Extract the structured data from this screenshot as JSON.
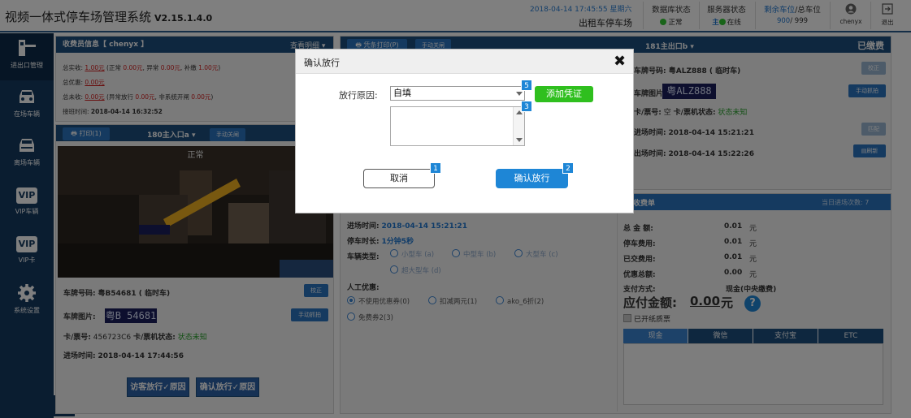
{
  "header": {
    "title": "视频一体式停车场管理系统",
    "version": "V2.15.1.4.0",
    "datetime": "2018-04-14 17:45:55 星期六",
    "lot_name": "出租车停车场",
    "db_status_label": "数据库状态",
    "db_status_value": "正常",
    "server_status_label": "服务器状态",
    "server_main": "主",
    "server_status_value": "在线",
    "spaces_label_remaining": "剩余车位",
    "spaces_label_total": "/总车位",
    "spaces_remaining": "900",
    "spaces_total": "/ 999",
    "user": "chenyx",
    "logout_label": "退出"
  },
  "sidebar": {
    "items": [
      {
        "label": "进出口管理",
        "icon": "gate-icon"
      },
      {
        "label": "在场车辆",
        "icon": "car-icon"
      },
      {
        "label": "离场车辆",
        "icon": "car-exit-icon"
      },
      {
        "label": "VIP车辆",
        "icon": "vip-icon"
      },
      {
        "label": "VIP卡",
        "icon": "vip-card-icon"
      },
      {
        "label": "系统设置",
        "icon": "gear-icon"
      }
    ],
    "vip_text": "VIP"
  },
  "cashier": {
    "title": "收费员信息【 chenyx 】",
    "detail_link": "查看明细",
    "total_label": "总实收:",
    "total_value": "1.00元",
    "total_detail_a": "(正常",
    "total_normal": "0.00元",
    "total_detail_b": ", 异常",
    "total_abnormal": "0.00元",
    "total_detail_c": ", 补缴",
    "total_supplement": "1.00元",
    "total_detail_d": ")",
    "discount_label": "总优惠:",
    "discount_value": "0.00元",
    "uncollected_label": "总未收:",
    "uncollected_value": "0.00元",
    "uncollected_detail_a": "(异常放行",
    "uncollected_release": "0.00元",
    "uncollected_detail_b": ", 非系统开闸",
    "uncollected_manual": "0.00元",
    "uncollected_detail_c": ")",
    "shift_label": "接班时间:",
    "shift_value": "2018-04-14 16:32:52"
  },
  "entrance": {
    "print_label": "打印(1)",
    "camera_name": "180主入口a",
    "manual_close": "手动关闸",
    "status": "正常",
    "plate_label": "车牌号码:",
    "plate_value": "粤B54681 ( 临时车)",
    "correct_btn": "校正",
    "plate_img_label": "车牌图片:",
    "plate_img_text": "粤B 54681",
    "capture_btn": "手动抓拍",
    "card_label": "卡/票号:",
    "card_value": "456723C6",
    "card_status_label": "卡/票机状态:",
    "card_status_value": "状态未知",
    "entry_time_label": "进场时间:",
    "entry_time_value": "2018-04-14 17:44:56",
    "visitor_release": "访客放行",
    "confirm_release": "确认放行",
    "reason_suffix": "原因"
  },
  "exit": {
    "ticket_print": "凭条打印(P)",
    "manual_close": "手动关闸",
    "camera_name": "181主出口b",
    "paid_status": "已缴费",
    "plate_label": "车牌号码:",
    "plate_value": "粤ALZ888 ( 临时车)",
    "correct_btn": "校正",
    "plate_img_label": "车牌图片:",
    "plate_img_text": "粤ALZ888",
    "capture_btn": "手动抓拍",
    "card_label": "卡/票号:",
    "card_value": "空",
    "card_status_label": "卡/票机状态:",
    "card_status_value": "状态未知",
    "entry_time_label": "进场时间:",
    "entry_time_value": "2018-04-14 15:21:21",
    "match_btn": "匹配",
    "exit_time_label": "出场时间:",
    "exit_time_value": "2018-04-14 15:22:26",
    "refresh_btn": "刷新"
  },
  "fee": {
    "title": "收费单",
    "today_entries_label": "当日进场次数:",
    "today_entries_value": "7",
    "entry_time_label": "进场时间:",
    "entry_time_value": "2018-04-14 15:21:21",
    "duration_label": "停车时长:",
    "duration_value": "1分钟5秒",
    "vehicle_type_label": "车辆类型:",
    "vehicle_types": [
      "小型车 (a)",
      "中型车 (b)",
      "大型车 (c)",
      "超大型车 (d)"
    ],
    "manual_discount_label": "人工优惠:",
    "discounts": [
      "不使用优惠券(0)",
      "扣减两元(1)",
      "ako_6折(2)",
      "免费券2(3)"
    ],
    "total_label": "总 金 额:",
    "total_value": "0.01",
    "parking_fee_label": "停车费用:",
    "parking_fee_value": "0.01",
    "paid_label": "已交费用:",
    "paid_value": "0.01",
    "discount_label": "优惠总额:",
    "discount_value": "0.00",
    "yuan": "元",
    "pay_method_label": "支付方式:",
    "pay_method_value": "现金",
    "pay_method_note": "(中央缴费)",
    "due_label": "应付金额:",
    "due_value": "0.00",
    "due_unit": "元",
    "paper_invoice": "已开纸质票",
    "help": "?",
    "tabs": [
      "现金",
      "微信",
      "支付宝",
      "ETC"
    ]
  },
  "dialog": {
    "title": "确认放行",
    "close": "✖",
    "reason_label": "放行原因:",
    "reason_value": "自填",
    "add_voucher": "添加凭证",
    "cancel": "取消",
    "confirm": "确认放行",
    "badges": {
      "cancel": "1",
      "confirm": "2",
      "remark": "3",
      "reason": "5"
    }
  },
  "colors": {
    "accent": "#1d4e7e",
    "confirm": "#1e86d6",
    "green": "#2fbf1e",
    "red": "#d32020"
  }
}
